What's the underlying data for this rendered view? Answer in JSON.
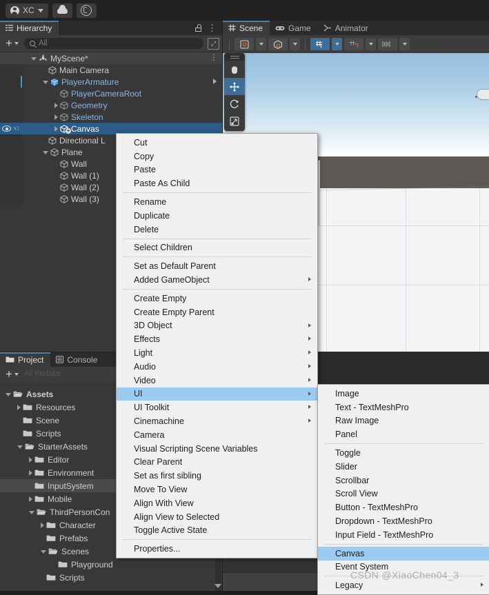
{
  "topbar": {
    "account_label": "XC",
    "icons": [
      "account-icon",
      "cloud-icon",
      "package-manager-icon"
    ]
  },
  "hierarchy": {
    "tab_label": "Hierarchy",
    "tab_icon": "hierarchy-icon",
    "search_placeholder": "All",
    "add_label": "+",
    "items": [
      {
        "label": "MyScene*",
        "indent": 0,
        "icon": "scene-icon",
        "state": "expanded",
        "kind": "scene"
      },
      {
        "label": "Main Camera",
        "indent": 1,
        "icon": "gameobject-icon",
        "state": "leaf",
        "kind": "normal"
      },
      {
        "label": "PlayerArmature",
        "indent": 1,
        "icon": "prefab-icon",
        "state": "expanded",
        "kind": "prefab"
      },
      {
        "label": "PlayerCameraRoot",
        "indent": 2,
        "icon": "gameobject-icon",
        "state": "leaf",
        "kind": "prefab-child"
      },
      {
        "label": "Geometry",
        "indent": 2,
        "icon": "gameobject-icon",
        "state": "collapsed",
        "kind": "prefab-child"
      },
      {
        "label": "Skeleton",
        "indent": 2,
        "icon": "gameobject-icon",
        "state": "collapsed",
        "kind": "prefab-child"
      },
      {
        "label": "Canvas",
        "indent": 2,
        "icon": "gameobject-icon",
        "state": "collapsed",
        "kind": "selected"
      },
      {
        "label": "Directional L",
        "indent": 1,
        "icon": "gameobject-icon",
        "state": "leaf",
        "kind": "normal"
      },
      {
        "label": "Plane",
        "indent": 1,
        "icon": "gameobject-icon",
        "state": "expanded",
        "kind": "normal"
      },
      {
        "label": "Wall",
        "indent": 2,
        "icon": "gameobject-icon",
        "state": "leaf",
        "kind": "normal"
      },
      {
        "label": "Wall (1)",
        "indent": 2,
        "icon": "gameobject-icon",
        "state": "leaf",
        "kind": "normal"
      },
      {
        "label": "Wall (2)",
        "indent": 2,
        "icon": "gameobject-icon",
        "state": "leaf",
        "kind": "normal"
      },
      {
        "label": "Wall (3)",
        "indent": 2,
        "icon": "gameobject-icon",
        "state": "leaf",
        "kind": "normal"
      }
    ]
  },
  "sceneview": {
    "tabs": [
      {
        "label": "Scene",
        "icon": "grid-icon",
        "active": true
      },
      {
        "label": "Game",
        "icon": "gamepad-icon",
        "active": false
      },
      {
        "label": "Animator",
        "icon": "animator-icon",
        "active": false
      }
    ],
    "toolbar": [
      {
        "name": "draw-mode-dropdown",
        "icon": "shaded-icon",
        "active": false
      },
      {
        "name": "2d-toggle-dropdown",
        "icon": "cube-icon",
        "active": false
      },
      {
        "name": "grid-snap-toggle",
        "icon": "grid-y-icon",
        "active": true
      },
      {
        "name": "snap-increment",
        "icon": "magnet-icon",
        "active": false
      },
      {
        "name": "component-tools",
        "icon": "ruler-icon",
        "active": false
      }
    ],
    "tool_palette": [
      {
        "name": "hand-tool",
        "icon": "hand-icon",
        "active": false
      },
      {
        "name": "move-tool",
        "icon": "move-icon",
        "active": true
      },
      {
        "name": "rotate-tool",
        "icon": "rotate-icon",
        "active": false
      },
      {
        "name": "scale-tool",
        "icon": "scale-icon",
        "active": false
      }
    ]
  },
  "project": {
    "tabs": [
      {
        "label": "Project",
        "icon": "folder-icon",
        "active": true
      },
      {
        "label": "Console",
        "icon": "console-icon",
        "active": false
      }
    ],
    "add_label": "+",
    "search_ghost": "All Prefabs",
    "items": [
      {
        "label": "Assets",
        "indent": 0,
        "state": "expanded",
        "selected": false
      },
      {
        "label": "Resources",
        "indent": 1,
        "state": "collapsed",
        "selected": false
      },
      {
        "label": "Scene",
        "indent": 1,
        "state": "leaf",
        "selected": false
      },
      {
        "label": "Scripts",
        "indent": 1,
        "state": "leaf",
        "selected": false
      },
      {
        "label": "StarterAssets",
        "indent": 1,
        "state": "expanded",
        "selected": false
      },
      {
        "label": "Editor",
        "indent": 2,
        "state": "collapsed",
        "selected": false
      },
      {
        "label": "Environment",
        "indent": 2,
        "state": "collapsed",
        "selected": false
      },
      {
        "label": "InputSystem",
        "indent": 2,
        "state": "leaf",
        "selected": true
      },
      {
        "label": "Mobile",
        "indent": 2,
        "state": "collapsed",
        "selected": false
      },
      {
        "label": "ThirdPersonCon",
        "indent": 2,
        "state": "expanded",
        "selected": false
      },
      {
        "label": "Character",
        "indent": 3,
        "state": "collapsed",
        "selected": false
      },
      {
        "label": "Prefabs",
        "indent": 3,
        "state": "leaf",
        "selected": false
      },
      {
        "label": "Scenes",
        "indent": 3,
        "state": "expanded",
        "selected": false
      },
      {
        "label": "Playground",
        "indent": 4,
        "state": "leaf",
        "selected": false
      },
      {
        "label": "Scripts",
        "indent": 3,
        "state": "leaf",
        "selected": false
      }
    ]
  },
  "context_menu": {
    "groups": [
      {
        "items": [
          {
            "label": "Cut",
            "submenu": false,
            "highlighted": false
          },
          {
            "label": "Copy",
            "submenu": false,
            "highlighted": false
          },
          {
            "label": "Paste",
            "submenu": false,
            "highlighted": false
          },
          {
            "label": "Paste As Child",
            "submenu": false,
            "highlighted": false
          }
        ]
      },
      {
        "items": [
          {
            "label": "Rename",
            "submenu": false,
            "highlighted": false
          },
          {
            "label": "Duplicate",
            "submenu": false,
            "highlighted": false
          },
          {
            "label": "Delete",
            "submenu": false,
            "highlighted": false
          }
        ]
      },
      {
        "items": [
          {
            "label": "Select Children",
            "submenu": false,
            "highlighted": false
          }
        ]
      },
      {
        "items": [
          {
            "label": "Set as Default Parent",
            "submenu": false,
            "highlighted": false
          },
          {
            "label": "Added GameObject",
            "submenu": true,
            "highlighted": false
          }
        ]
      },
      {
        "items": [
          {
            "label": "Create Empty",
            "submenu": false,
            "highlighted": false
          },
          {
            "label": "Create Empty Parent",
            "submenu": false,
            "highlighted": false
          },
          {
            "label": "3D Object",
            "submenu": true,
            "highlighted": false
          },
          {
            "label": "Effects",
            "submenu": true,
            "highlighted": false
          },
          {
            "label": "Light",
            "submenu": true,
            "highlighted": false
          },
          {
            "label": "Audio",
            "submenu": true,
            "highlighted": false
          },
          {
            "label": "Video",
            "submenu": true,
            "highlighted": false
          },
          {
            "label": "UI",
            "submenu": true,
            "highlighted": true
          },
          {
            "label": "UI Toolkit",
            "submenu": true,
            "highlighted": false
          },
          {
            "label": "Cinemachine",
            "submenu": true,
            "highlighted": false
          },
          {
            "label": "Camera",
            "submenu": false,
            "highlighted": false
          },
          {
            "label": "Visual Scripting Scene Variables",
            "submenu": false,
            "highlighted": false
          },
          {
            "label": "Clear Parent",
            "submenu": false,
            "highlighted": false
          },
          {
            "label": "Set as first sibling",
            "submenu": false,
            "highlighted": false
          },
          {
            "label": "Move To View",
            "submenu": false,
            "highlighted": false
          },
          {
            "label": "Align With View",
            "submenu": false,
            "highlighted": false
          },
          {
            "label": "Align View to Selected",
            "submenu": false,
            "highlighted": false
          },
          {
            "label": "Toggle Active State",
            "submenu": false,
            "highlighted": false
          }
        ]
      },
      {
        "items": [
          {
            "label": "Properties...",
            "submenu": false,
            "highlighted": false
          }
        ]
      }
    ]
  },
  "ui_submenu": {
    "groups": [
      {
        "items": [
          {
            "label": "Image",
            "submenu": false,
            "highlighted": false
          },
          {
            "label": "Text - TextMeshPro",
            "submenu": false,
            "highlighted": false
          },
          {
            "label": "Raw Image",
            "submenu": false,
            "highlighted": false
          },
          {
            "label": "Panel",
            "submenu": false,
            "highlighted": false
          }
        ]
      },
      {
        "items": [
          {
            "label": "Toggle",
            "submenu": false,
            "highlighted": false
          },
          {
            "label": "Slider",
            "submenu": false,
            "highlighted": false
          },
          {
            "label": "Scrollbar",
            "submenu": false,
            "highlighted": false
          },
          {
            "label": "Scroll View",
            "submenu": false,
            "highlighted": false
          },
          {
            "label": "Button - TextMeshPro",
            "submenu": false,
            "highlighted": false
          },
          {
            "label": "Dropdown - TextMeshPro",
            "submenu": false,
            "highlighted": false
          },
          {
            "label": "Input Field - TextMeshPro",
            "submenu": false,
            "highlighted": false
          }
        ]
      },
      {
        "items": [
          {
            "label": "Canvas",
            "submenu": false,
            "highlighted": true
          },
          {
            "label": "Event System",
            "submenu": false,
            "highlighted": false
          }
        ]
      },
      {
        "items": [
          {
            "label": "Legacy",
            "submenu": true,
            "highlighted": false
          }
        ]
      }
    ]
  },
  "watermark": {
    "text": "CSDN @XiaoChen04_3"
  },
  "colors": {
    "accent_blue": "#2c5d87",
    "menu_highlight": "#9bcbf0",
    "panel_bg": "#383838",
    "toolbar_bg": "#3c3c3c",
    "tab_active": "#3a3a3a",
    "prefab_blue": "#8cb4e2"
  }
}
